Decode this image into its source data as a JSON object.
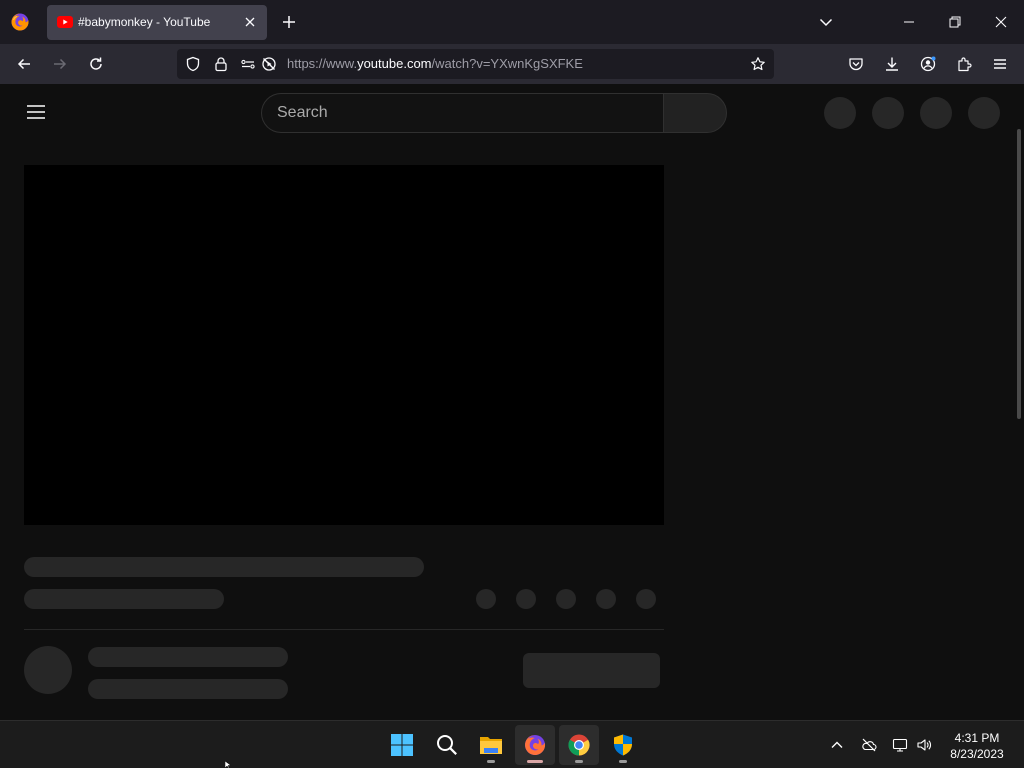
{
  "browser": {
    "tab": {
      "title": "#babymonkey - YouTube",
      "favicon": "youtube-icon"
    },
    "url": {
      "prefix": "https://www.",
      "host": "youtube.com",
      "path": "/watch?v=YXwnKgSXFKE"
    }
  },
  "youtube": {
    "search": {
      "placeholder": "Search"
    }
  },
  "taskbar": {
    "apps": [
      "start-icon",
      "search-icon",
      "file-explorer-icon",
      "firefox-icon",
      "chrome-icon",
      "security-shield-icon"
    ],
    "clock": {
      "time": "4:31 PM",
      "date": "8/23/2023"
    }
  },
  "colors": {
    "page_background": "#0f0f0f",
    "skeleton": "#272727",
    "youtube_red": "#ff0000"
  }
}
